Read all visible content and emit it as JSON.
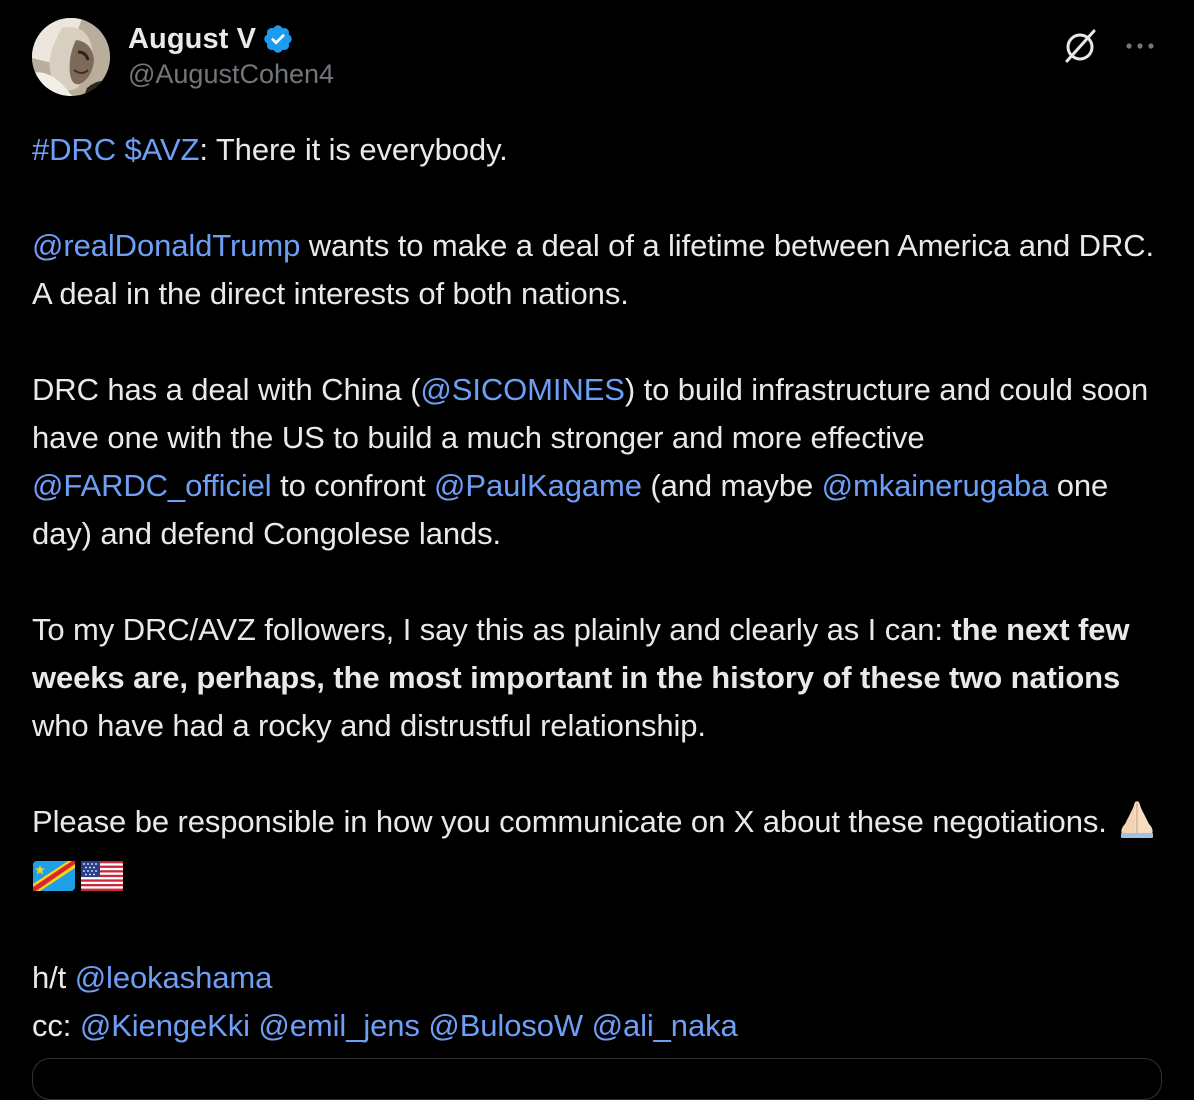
{
  "author": {
    "display_name": "August V",
    "handle": "@AugustCohen4",
    "verified": true
  },
  "colors": {
    "background": "#000000",
    "text": "#e7e9ea",
    "secondary_text": "#71767b",
    "link": "#6e9ff7",
    "verified_badge": "#1d9bf0"
  },
  "icons": {
    "grok": "grok-icon",
    "more": "more-icon",
    "verified": "verified-badge-icon"
  },
  "tweet": {
    "p1": {
      "tag1": "#DRC",
      "tag2": "$AVZ",
      "text": ":  There it is everybody."
    },
    "p2": {
      "mention": "@realDonaldTrump",
      "text": " wants to make a deal of a lifetime between America and DRC. A deal in the direct interests of both nations."
    },
    "p3": {
      "t1": "DRC has a deal with China (",
      "m1": "@SICOMINES",
      "t2": ") to build infrastructure and could soon have one with the US to build a much stronger and more effective ",
      "m2": "@FARDC_officiel",
      "t3": " to confront ",
      "m3": "@PaulKagame",
      "t4": " (and maybe ",
      "m4": "@mkainerugaba",
      "t5": " one day)  and defend Congolese lands."
    },
    "p4": {
      "t1": "To my DRC/AVZ followers, I say this as plainly and clearly as I can: ",
      "bold": "the next few weeks are, perhaps, the most important in the history of these two nations",
      "t2": " who have had a rocky and distrustful relationship."
    },
    "p5": {
      "text": "Please be responsible in how you communicate on X about these negotiations. ",
      "emojis": [
        "folded-hands-emoji",
        "flag-drc-emoji",
        "flag-us-emoji"
      ]
    },
    "p6": {
      "ht_label": "h/t ",
      "ht_mention": "@leokashama",
      "cc_label": "cc: ",
      "cc_mentions": [
        "@KiengeKki",
        "@emil_jens",
        "@BulosoW",
        "@ali_naka"
      ]
    }
  }
}
